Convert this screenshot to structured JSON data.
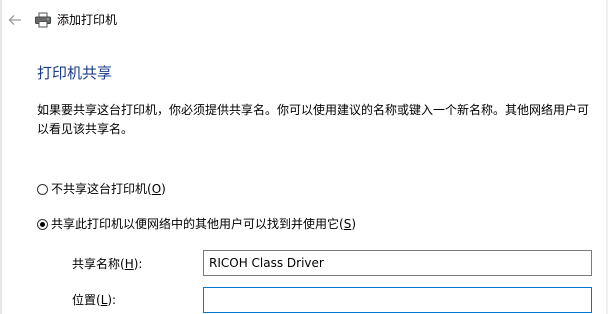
{
  "header": {
    "title": "添加打印机",
    "back_icon": "back-arrow-icon",
    "printer_icon": "printer-icon"
  },
  "section": {
    "title": "打印机共享",
    "description": "如果要共享这台打印机，你必须提供共享名。你可以使用建议的名称或键入一个新名称。其他网络用户可以看见该共享名。"
  },
  "options": {
    "no_share": {
      "label": "不共享这台打印机(",
      "accel": "O",
      "suffix": ")",
      "selected": false
    },
    "share": {
      "label": "共享此打印机以便网络中的其他用户可以找到并使用它(",
      "accel": "S",
      "suffix": ")",
      "selected": true
    }
  },
  "fields": {
    "share_name": {
      "label": "共享名称(",
      "accel": "H",
      "suffix": "):",
      "value": "RICOH Class Driver"
    },
    "location": {
      "label": "位置(",
      "accel": "L",
      "suffix": "):",
      "value": ""
    }
  },
  "colors": {
    "section_title": "#1a3c8c",
    "focus_border": "#0078d7"
  }
}
